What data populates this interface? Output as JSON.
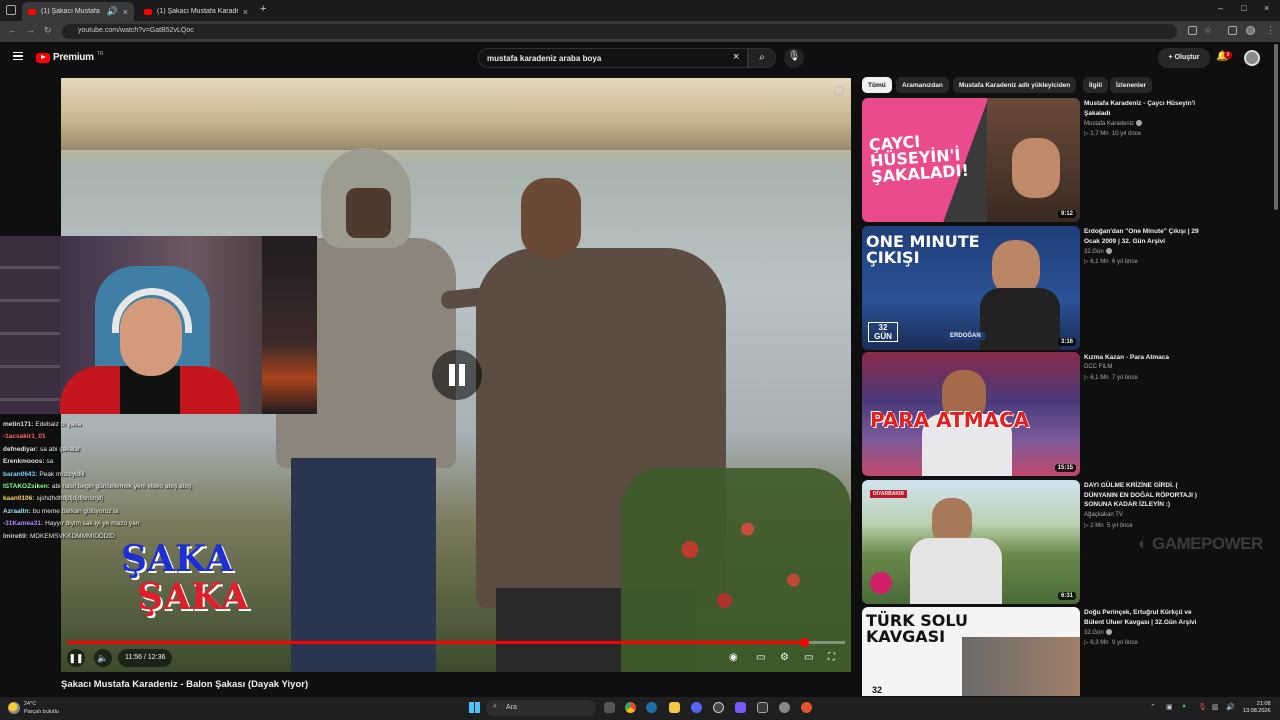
{
  "browser": {
    "tabs": [
      {
        "title": "(1) Şakacı Mustafa Karadeniz - Balon Şakası (Dayak Yiyor)",
        "active": true
      },
      {
        "title": "(1) Şakacı Mustafa Karadeniz - Balon Şakası",
        "active": false
      }
    ],
    "url": "youtube.com/watch?v=GatB52vLQoc"
  },
  "youtube": {
    "logo_text": "Premium",
    "logo_region": "TR",
    "search_query": "mustafa karadeniz araba boya",
    "create_label": "Oluştur",
    "notification_count": "9"
  },
  "video": {
    "title": "Şakacı Mustafa Karadeniz - Balon Şakası (Dayak Yiyor)",
    "current_time": "11:56",
    "duration": "12:36",
    "time_display": "11:56 / 12:36",
    "progress": 0.947,
    "overlay_logo": {
      "line1": "ŞAKA",
      "line2": "ŞAKA"
    }
  },
  "chat": [
    {
      "user": "metin171:",
      "msg": "Edebaiz bi yaka",
      "color": "#e5e5e5"
    },
    {
      "user": "-1acsakir1_01",
      "msg": "",
      "color": "#ff6b6b"
    },
    {
      "user": "defnediyar:",
      "msg": "sa abi şakalar",
      "color": "#e5e5e5"
    },
    {
      "user": "Erenkmooos:",
      "msg": "sa",
      "color": "#e5e5e5"
    },
    {
      "user": "baran0643:",
      "msg": "Peak müzeyidiii",
      "color": "#7fd3ff"
    },
    {
      "user": "ISTAKOZsiken:",
      "msg": "abi nasıl begin güncellemek yeni video ateş ateş",
      "color": "#8cff8c"
    },
    {
      "user": "kaan0106:",
      "msg": "sjshdhdhdjdjdjdjsnsnjdj",
      "color": "#ffd966"
    },
    {
      "user": "Azraaltn:",
      "msg": "bu meme barkan gülüyoruz la",
      "color": "#9be7ff"
    },
    {
      "user": "-31Kamea31:",
      "msg": "Hayyır diyim sak iyi ye mazo yan",
      "color": "#b58cff"
    },
    {
      "user": "lmire69:",
      "msg": "MDKEMSVKKDMMMIDDDID",
      "color": "#cfcfcf"
    }
  ],
  "filters": [
    "Tümü",
    "Aramanızdan",
    "Mustafa Karadeniz adlı yükleyiciden",
    "İlgili",
    "İzlenenler"
  ],
  "related": [
    {
      "title": "Mustafa Karadeniz - Çaycı Hüseyin'i Şakaladı",
      "channel": "Mustafa Karadeniz",
      "verified": true,
      "views": "1,7 Mn",
      "age": "10 yıl önce",
      "duration": "9:12",
      "thumb_text": "ÇAYCI HÜSEYİN'İ ŞAKALADI!"
    },
    {
      "title": "Erdoğan'dan \"One Minute\" Çıkışı | 29 Ocak 2009 | 32. Gün Arşivi",
      "channel": "32.Gün",
      "verified": true,
      "views": "6,1 Mn",
      "age": "6 yıl önce",
      "duration": "3:16",
      "thumb_text": "ONE MINUTE ÇIKIŞI",
      "thumb_caption": "ERDOĞAN",
      "thumb_badge": "32 GÜN"
    },
    {
      "title": "Kızma Kazan - Para Atmaca",
      "channel": "DCC FILM",
      "verified": false,
      "views": "6,1 Mn",
      "age": "7 yıl önce",
      "duration": "15:15",
      "thumb_text": "PARA ATMACA"
    },
    {
      "title": "DAYI GÜLME KRİZİNE GİRDİ. ( DÜNYANIN EN DOĞAL RÖPORTAJI ) SONUNA KADAR İZLEYİN :)",
      "channel": "Ağaçkakan TV",
      "verified": false,
      "views": "2 Mn",
      "age": "5 yıl önce",
      "duration": "6:31",
      "thumb_badge": "DİYARBAKIR"
    },
    {
      "title": "Doğu Perinçek, Ertuğrul Kürkçü ve Bülent Uluer Kavgası | 32.Gün Arşivi",
      "channel": "32.Gün",
      "verified": true,
      "views": "6,3 Mn",
      "age": "9 yıl önce",
      "duration": "",
      "thumb_text": "TÜRK SOLU KAVGASI",
      "thumb_badge": "32"
    }
  ],
  "watermark": "GAMEPOWER",
  "taskbar": {
    "weather_temp": "24°C",
    "weather_desc": "Parçalı bulutlu",
    "search_placeholder": "Ara",
    "time": "21:08",
    "date": "13.08.2026"
  },
  "colors": {
    "youtube_red": "#ff0000",
    "background": "#0f0f0f",
    "chip_bg": "#272727"
  }
}
